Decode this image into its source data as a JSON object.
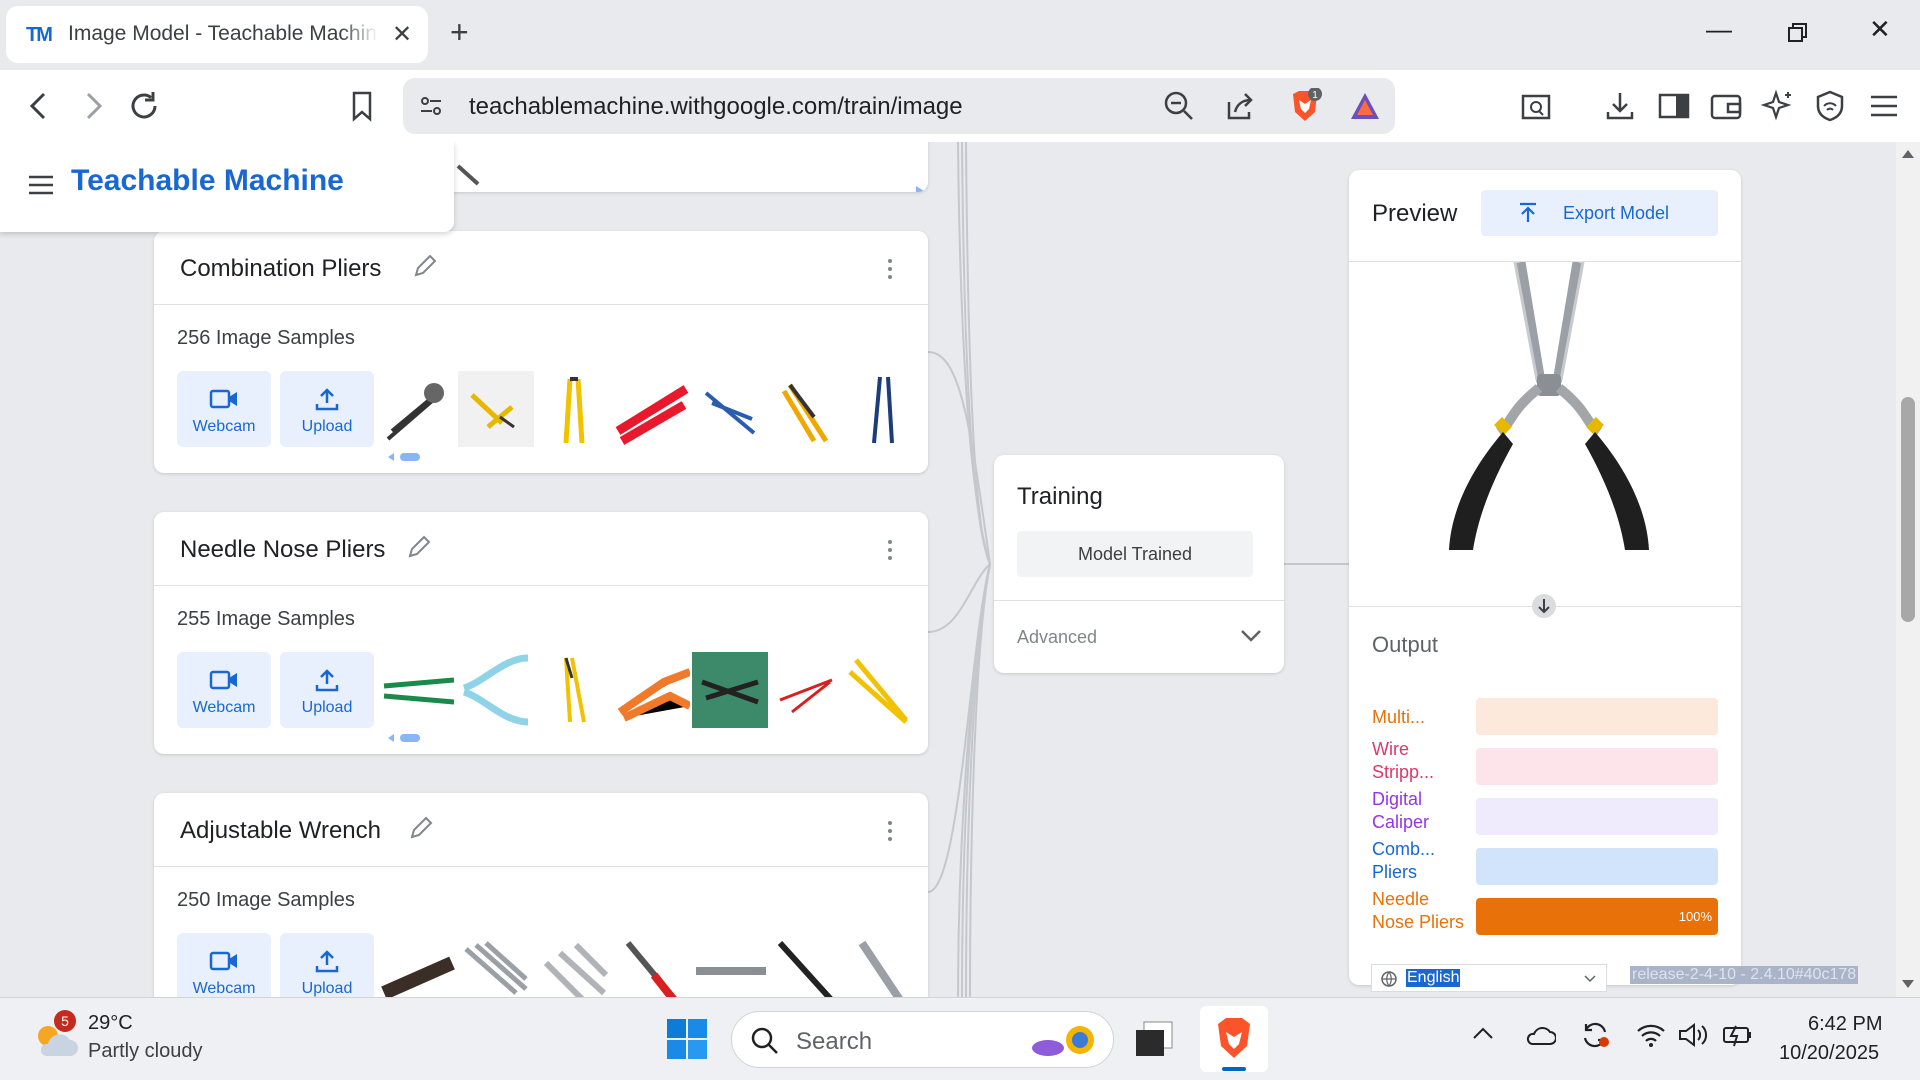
{
  "browser": {
    "tab_title": "Image Model - Teachable Machine",
    "tab_favicon": "TM",
    "url": "teachablemachine.withgoogle.com/train/image",
    "extension_badge": "1"
  },
  "app": {
    "brand": "Teachable Machine"
  },
  "classes": [
    {
      "name": "Combination Pliers",
      "samples": "256 Image Samples",
      "webcam_label": "Webcam",
      "upload_label": "Upload"
    },
    {
      "name": "Needle Nose Pliers",
      "samples": "255 Image Samples",
      "webcam_label": "Webcam",
      "upload_label": "Upload"
    },
    {
      "name": "Adjustable Wrench",
      "samples": "250 Image Samples",
      "webcam_label": "Webcam",
      "upload_label": "Upload"
    }
  ],
  "training": {
    "title": "Training",
    "button": "Model Trained",
    "advanced": "Advanced"
  },
  "preview": {
    "title": "Preview",
    "export": "Export Model",
    "output_title": "Output",
    "outputs": [
      {
        "label": "Multi...",
        "value": 0,
        "color": "#e8710a",
        "track": "#fde9dc"
      },
      {
        "label": "Wire Stripp...",
        "value": 0,
        "color": "#d93a6a",
        "track": "#fce4ea"
      },
      {
        "label": "Digital Caliper",
        "value": 0,
        "color": "#9334e6",
        "track": "#efeafc"
      },
      {
        "label": "Comb... Pliers",
        "value": 0,
        "color": "#1967d2",
        "track": "#d2e3fc"
      },
      {
        "label": "Needle Nose Pliers",
        "value": 100,
        "percent_text": "100%",
        "color": "#e8710a",
        "track": "#fde9dc"
      }
    ]
  },
  "footer": {
    "language": "English",
    "release": "release-2-4-10 - 2.4.10#40c178"
  },
  "taskbar": {
    "weather_badge": "5",
    "temperature": "29°C",
    "weather": "Partly cloudy",
    "search": "Search",
    "time": "6:42 PM",
    "date": "10/20/2025"
  },
  "colors": {
    "brand": "#1967d2",
    "page_bg": "#e8eaed"
  }
}
